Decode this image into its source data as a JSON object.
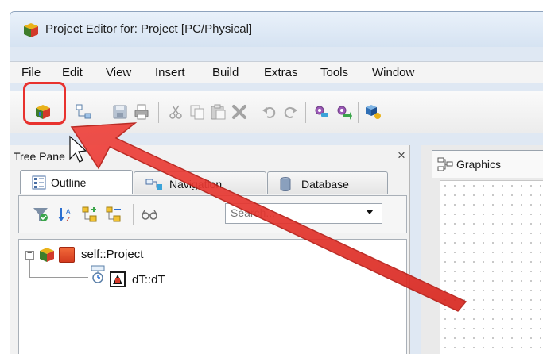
{
  "window": {
    "title": "Project Editor for: Project [PC/Physical]"
  },
  "menu": [
    "File",
    "Edit",
    "View",
    "Insert",
    "Build",
    "Extras",
    "Tools",
    "Window"
  ],
  "toolbar": {
    "icons": [
      "project-cube-icon",
      "tree-view-icon",
      "save-icon",
      "print-icon",
      "cut-icon",
      "copy-icon",
      "paste-icon",
      "delete-icon",
      "undo-icon",
      "redo-icon",
      "gear-plug-icon",
      "gear-arrow-icon",
      "cube-add-icon"
    ]
  },
  "tree_pane": {
    "title": "Tree Pane",
    "close_label": "×",
    "tabs": [
      {
        "label": "Outline",
        "active": true
      },
      {
        "label": "Navigation",
        "active": false
      },
      {
        "label": "Database",
        "active": false
      }
    ],
    "search": {
      "placeholder": "Search...",
      "value": ""
    },
    "tree": [
      {
        "label": "self::Project",
        "expand_symbol": "−",
        "level": 0
      },
      {
        "label": "dT::dT",
        "level": 1
      }
    ]
  },
  "graphics": {
    "tab_label": "Graphics"
  },
  "colors": {
    "highlight": "#e8322e",
    "arrow": "#e8322e"
  }
}
